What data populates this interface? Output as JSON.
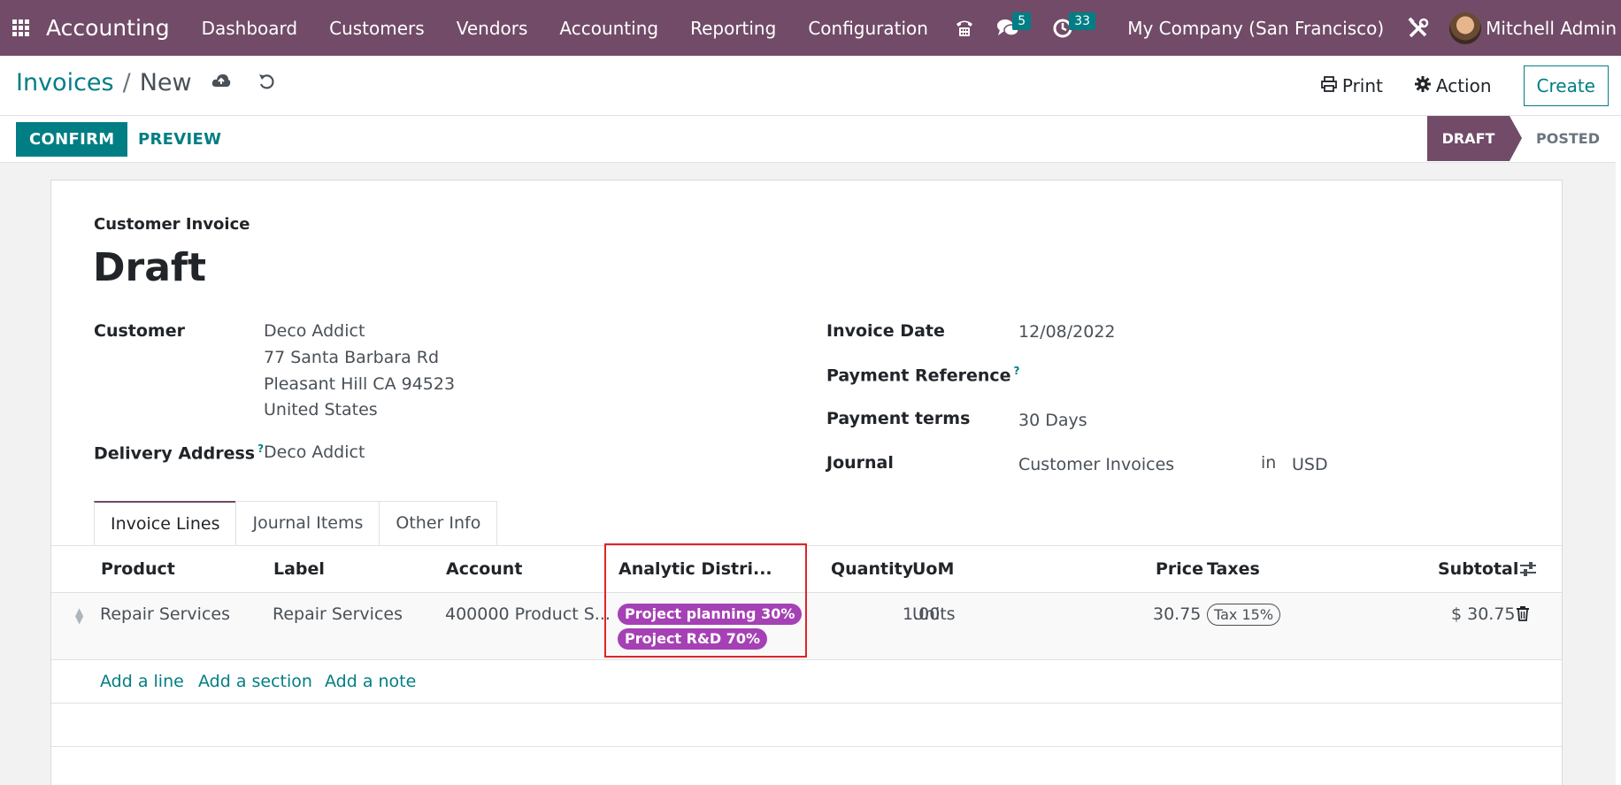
{
  "navbar": {
    "brand": "Accounting",
    "menu": [
      "Dashboard",
      "Customers",
      "Vendors",
      "Accounting",
      "Reporting",
      "Configuration"
    ],
    "messages_count": "5",
    "activities_count": "33",
    "company": "My Company (San Francisco)",
    "user": "Mitchell Admin"
  },
  "control": {
    "breadcrumb_parent": "Invoices",
    "breadcrumb_sep": "/",
    "breadcrumb_current": "New",
    "print_label": "Print",
    "action_label": "Action",
    "create_label": "Create"
  },
  "statusbar": {
    "confirm_label": "CONFIRM",
    "preview_label": "PREVIEW",
    "stages": [
      "DRAFT",
      "POSTED"
    ],
    "active_stage": "DRAFT"
  },
  "form": {
    "subtitle": "Customer Invoice",
    "title": "Draft",
    "customer_label": "Customer",
    "customer_lines": [
      "Deco Addict",
      "77 Santa Barbara Rd",
      "Pleasant Hill CA 94523",
      "United States"
    ],
    "delivery_label": "Delivery Address",
    "delivery_value": "Deco Addict",
    "invoice_date_label": "Invoice Date",
    "invoice_date_value": "12/08/2022",
    "payment_ref_label": "Payment Reference",
    "payment_terms_label": "Payment terms",
    "payment_terms_value": "30 Days",
    "journal_label": "Journal",
    "journal_value": "Customer Invoices",
    "journal_in": "in",
    "currency": "USD",
    "help_mark": "?"
  },
  "tabs": [
    "Invoice Lines",
    "Journal Items",
    "Other Info"
  ],
  "table": {
    "headers": {
      "product": "Product",
      "label": "Label",
      "account": "Account",
      "analytic": "Analytic Distri...",
      "quantity": "Quantity",
      "uom": "UoM",
      "price": "Price",
      "taxes": "Taxes",
      "subtotal": "Subtotal"
    },
    "row": {
      "product": "Repair Services",
      "label": "Repair Services",
      "account": "400000 Product S...",
      "analytic_tags": [
        "Project planning 30%",
        "Project R&D 70%"
      ],
      "quantity": "1.00",
      "uom": "Units",
      "price": "30.75",
      "tax": "Tax 15%",
      "subtotal": "$ 30.75"
    },
    "add_links": [
      "Add a line",
      "Add a section",
      "Add a note"
    ]
  },
  "colors": {
    "brand": "#714b67",
    "accent": "#017e84",
    "tag": "#a541b5",
    "highlight": "#e02424"
  }
}
